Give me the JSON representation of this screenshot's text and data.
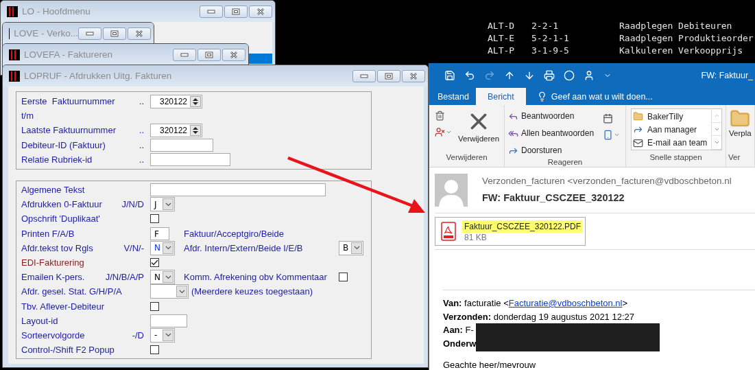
{
  "console": {
    "rows": [
      {
        "key": "ALT-D",
        "code": "2-2-1",
        "description": "Raadplegen Debiteuren"
      },
      {
        "key": "ALT-E",
        "code": "5-2-1-1",
        "description": "Raadplegen Produktieorder"
      },
      {
        "key": "ALT-P",
        "code": "3-1-9-5",
        "description": "Kalkuleren Verkoopprijs"
      }
    ]
  },
  "windows": [
    {
      "title": "LO - Hoofdmenu"
    },
    {
      "title": "LOVE - Verko..."
    },
    {
      "title": "LOVEFA - Faktureren"
    }
  ],
  "form_window": {
    "title": "LOPRUF - Afdrukken Uitg. Fakturen",
    "groups": [
      {
        "rows": [
          {
            "kind": "spin",
            "label": "Eerste  Faktuurnummer",
            "hint": "..",
            "value": "320122"
          },
          {
            "kind": "label",
            "label": "t/m"
          },
          {
            "kind": "spin",
            "label": "Laatste Faktuurnummer",
            "hint": "..",
            "value": "320122"
          },
          {
            "kind": "text",
            "label": "Debiteur-ID (Faktuur)",
            "hint": ".."
          },
          {
            "kind": "text",
            "label": "Relatie Rubriek-id",
            "hint": ".."
          }
        ]
      },
      {
        "rows": [
          {
            "kind": "text",
            "label": "Algemene Tekst"
          },
          {
            "kind": "select",
            "label": "Afdrukken 0-Faktuur",
            "hint": "J/N/D",
            "value": "J",
            "focused": false
          },
          {
            "kind": "check",
            "label": "Opschrift 'Duplikaat'",
            "checked": false,
            "modified": false
          },
          {
            "kind": "text",
            "label": "Printen F/A/B",
            "value": "F",
            "extra": {
              "kind": "note",
              "text": "Faktuur/Acceptgiro/Beide"
            }
          },
          {
            "kind": "select",
            "label": "Afdr.tekst tov Rgls",
            "hint": "V/N/-",
            "value": "N",
            "focused": true,
            "extra": {
              "kind": "select",
              "label": "Afdr. Intern/Extern/Beide I/E/B",
              "value": "B",
              "focused": false
            }
          },
          {
            "kind": "check",
            "label": "EDI-Fakturering",
            "checked": true,
            "modified": true
          },
          {
            "kind": "select",
            "label": "Emailen K-pers.",
            "hint": "J/N/B/A/P",
            "value": "N",
            "focused": false,
            "extra": {
              "kind": "check",
              "label": "Komm. Afrekening obv Kommentaar",
              "checked": false
            }
          },
          {
            "kind": "select",
            "label": "Afdr. gesel. Stat. G/H/P/A",
            "extra": {
              "kind": "remark",
              "text": "(Meerdere keuzes toegestaan)"
            }
          },
          {
            "kind": "check",
            "label": "Tbv. Aflever-Debiteur",
            "checked": false,
            "modified": false
          },
          {
            "kind": "text",
            "label": "Layout-id"
          },
          {
            "kind": "select",
            "label": "Sorteervolgorde",
            "hint": "-/D",
            "value": "-",
            "focused": false
          },
          {
            "kind": "check",
            "label": "Control-/Shift F2 Popup",
            "checked": false,
            "modified": false
          }
        ]
      }
    ]
  },
  "outlook": {
    "title": "FW: Faktuur_",
    "tabs": [
      {
        "label": "Bestand",
        "selected": false
      },
      {
        "label": "Bericht",
        "selected": true
      }
    ],
    "tell_me": "Geef aan wat u wilt doen...",
    "ribbon": {
      "delete_group": {
        "label": "Verwijderen",
        "button": "Verwijderen"
      },
      "respond_group": {
        "label": "Reageren",
        "buttons": [
          {
            "label": "Beantwoorden",
            "kind": "reply"
          },
          {
            "label": "Allen beantwoorden",
            "kind": "reply_all"
          },
          {
            "label": "Doorsturen",
            "kind": "forward"
          }
        ]
      },
      "quick_steps": {
        "label": "Snelle stappen",
        "items": [
          {
            "label": "BakerTilly",
            "kind": "folder"
          },
          {
            "label": "Aan manager",
            "kind": "forward"
          },
          {
            "label": "E-mail aan team",
            "kind": "mail"
          }
        ]
      },
      "move_group": {
        "label": "Ver",
        "button": "Verpla"
      }
    },
    "message": {
      "sender": "Verzonden_facturen <verzonden_facturen@vdboschbeton.nl",
      "subject": "FW: Faktuur_CSCZEE_320122",
      "attachment": {
        "name": "Faktuur_CSCZEE_320122.PDF",
        "size": "81 KB",
        "selected": true
      },
      "from": {
        "label": "Van:",
        "name": "facturatie <",
        "email": "Facturatie@vdboschbeton.nl",
        "after": ">"
      },
      "sent": "**Verzonden:** donderdag 19 augustus 2021 12:27",
      "to": "**Aan:** F-",
      "subject_line": "Onderw",
      "greeting": "Geachte heer/mevrouw"
    }
  }
}
